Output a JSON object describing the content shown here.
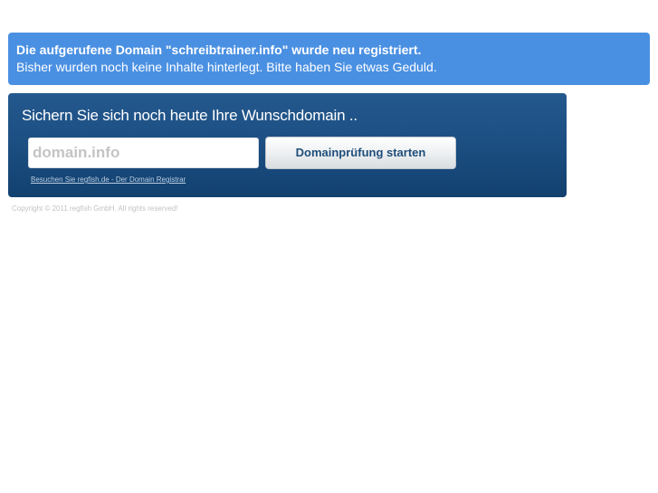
{
  "notice": {
    "title": "Die aufgerufene Domain \"schreibtrainer.info\" wurde neu registriert.",
    "text": "Bisher wurden noch keine Inhalte hinterlegt. Bitte haben Sie etwas Geduld."
  },
  "domain_search": {
    "heading": "Sichern Sie sich noch heute Ihre Wunschdomain ..",
    "input_placeholder": "domain.info",
    "input_value": "",
    "button_label": "Domainprüfung starten",
    "link_text": "Besuchen Sie regfish.de - Der Domain Registrar"
  },
  "footer": {
    "copyright": "Copyright © 2011 regfish GmbH. All rights reserved!"
  },
  "colors": {
    "notice_background": "#4a90e2",
    "panel_background": "#1c4e82",
    "button_text": "#1f4e7a"
  }
}
